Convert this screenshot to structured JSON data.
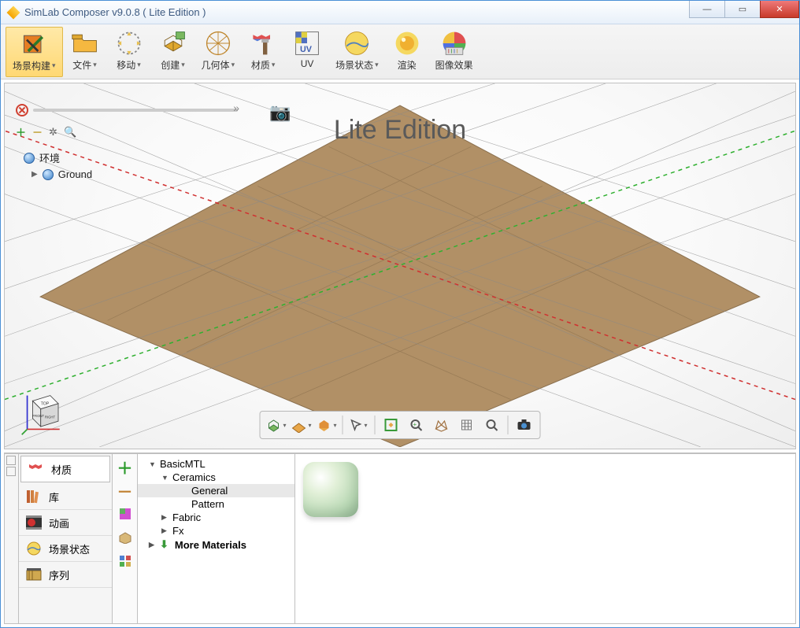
{
  "title": "SimLab Composer v9.0.8 ( Lite Edition )",
  "watermark": "Lite Edition",
  "ribbon": {
    "scene_build": "场景构建",
    "file": "文件",
    "move": "移动",
    "create": "创建",
    "geometry": "几何体",
    "material": "材质",
    "uv": "UV",
    "scene_state": "场景状态",
    "render": "渲染",
    "image_fx": "图像效果"
  },
  "scene_tree": {
    "env": "环境",
    "ground": "Ground"
  },
  "viewcube": {
    "top": "TOP",
    "front": "FRONT",
    "right": "RIGHT"
  },
  "tabs": {
    "material": "材质",
    "library": "库",
    "animation": "动画",
    "scene_state": "场景状态",
    "sequence": "序列"
  },
  "mat_tree": {
    "root": "BasicMTL",
    "ceramics": "Ceramics",
    "general": "General",
    "pattern": "Pattern",
    "fabric": "Fabric",
    "fx": "Fx",
    "more": "More Materials"
  }
}
